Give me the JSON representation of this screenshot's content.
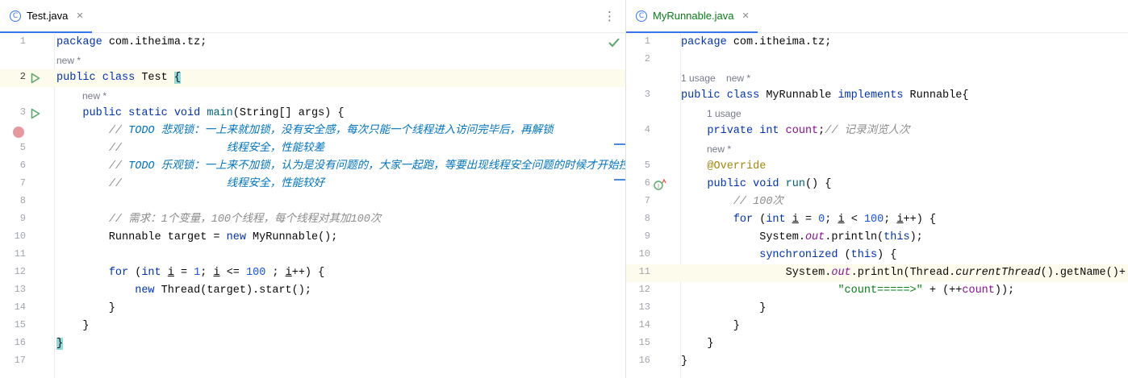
{
  "left": {
    "tab": {
      "name": "Test.java",
      "icon": "class-icon"
    },
    "lines": [
      {
        "n": "1",
        "html": "<span class='kw'>package</span> com.itheima.tz;"
      },
      {
        "hint": "new *",
        "indent": 0
      },
      {
        "n": "2",
        "html": "<span class='kw'>public class</span> Test <span class='brace-hl'>{</span>",
        "highlight": true,
        "current": true,
        "run": true
      },
      {
        "hint": "new *",
        "indent": 32
      },
      {
        "n": "3",
        "html": "    <span class='kw'>public static void</span> <span class='fn'>main</span>(String[] args) {",
        "run": true
      },
      {
        "n": "",
        "html": "        <span class='cm'>// </span><span class='todo'>TODO 悲观锁：一上来就加锁，没有安全感，每次只能一个线程进入访问完毕后，再解锁</span>",
        "breakpoint": true
      },
      {
        "n": "5",
        "html": "        <span class='cm'>// </span><span class='todo'>               线程安全，性能较差</span>"
      },
      {
        "n": "6",
        "html": "        <span class='cm'>// </span><span class='todo'>TODO 乐观锁：一上来不加锁，认为是没有问题的，大家一起跑，等要出现线程安全问题的时候才开始控制</span>"
      },
      {
        "n": "7",
        "html": "        <span class='cm'>// </span><span class='todo'>               线程安全，性能较好</span>"
      },
      {
        "n": "8",
        "html": ""
      },
      {
        "n": "9",
        "html": "        <span class='cm'>// 需求：1个变量，100个线程，每个线程对其加100次</span>"
      },
      {
        "n": "10",
        "html": "        Runnable target = <span class='kw'>new</span> MyRunnable();"
      },
      {
        "n": "11",
        "html": ""
      },
      {
        "n": "12",
        "html": "        <span class='kw'>for</span> (<span class='kw'>int</span> <span class='ul'>i</span> = <span class='num'>1</span>; <span class='ul'>i</span> &lt;= <span class='num'>100</span> ; <span class='ul'>i</span>++) {"
      },
      {
        "n": "13",
        "html": "            <span class='kw'>new</span> Thread(target).start();"
      },
      {
        "n": "14",
        "html": "        }"
      },
      {
        "n": "15",
        "html": "    }"
      },
      {
        "n": "16",
        "html": "<span class='brace-hl'>}</span>"
      },
      {
        "n": "17",
        "html": ""
      }
    ]
  },
  "right": {
    "tab": {
      "name": "MyRunnable.java",
      "icon": "class-icon"
    },
    "lines": [
      {
        "n": "1",
        "html": "<span class='kw'>package</span> com.itheima.tz;"
      },
      {
        "n": "2",
        "html": ""
      },
      {
        "hint": "1 usage|new *",
        "indent": 0
      },
      {
        "n": "3",
        "html": "<span class='kw'>public class</span> MyRunnable <span class='kw'>implements</span> Runnable{"
      },
      {
        "hint": "1 usage",
        "indent": 32
      },
      {
        "n": "4",
        "html": "    <span class='kw'>private int</span> <span class='fld'>count</span>;<span class='cm'>// 记录浏览人次</span>"
      },
      {
        "hint": "new *",
        "indent": 32
      },
      {
        "n": "5",
        "html": "    <span class='ann'>@Override</span>"
      },
      {
        "n": "6",
        "html": "    <span class='kw'>public void</span> <span class='fn'>run</span>() {",
        "override": true
      },
      {
        "n": "7",
        "html": "        <span class='cm'>// 100次</span>"
      },
      {
        "n": "8",
        "html": "        <span class='kw'>for</span> (<span class='kw'>int</span> <span class='ul'>i</span> = <span class='num'>0</span>; <span class='ul'>i</span> &lt; <span class='num'>100</span>; <span class='ul'>i</span>++) {"
      },
      {
        "n": "9",
        "html": "            System.<span class='sfld'>out</span>.println(<span class='kw'>this</span>);"
      },
      {
        "n": "10",
        "html": "            <span class='kw'>synchronized</span> (<span class='kw'>this</span>) {"
      },
      {
        "n": "11",
        "html": "                System.<span class='sfld'>out</span>.println(Thread.<span class='smeth'>currentThread</span>().getName()+",
        "highlight": true
      },
      {
        "n": "12",
        "html": "                        <span class='str'>\"count=====>\"</span> + (++<span class='fld'>count</span>));"
      },
      {
        "n": "13",
        "html": "            }"
      },
      {
        "n": "14",
        "html": "        }"
      },
      {
        "n": "15",
        "html": "    }"
      },
      {
        "n": "16",
        "html": "}"
      }
    ]
  },
  "colors": {
    "accent": "#3574f0",
    "run": "#59a869",
    "breakpoint": "#e5999d",
    "highlight_line": "#fdfbec",
    "brace_match": "#93d9d9"
  },
  "icons": [
    "class-icon",
    "close-icon",
    "more-options-icon",
    "run-icon",
    "breakpoint-icon",
    "override-icon",
    "checkmark-icon"
  ]
}
